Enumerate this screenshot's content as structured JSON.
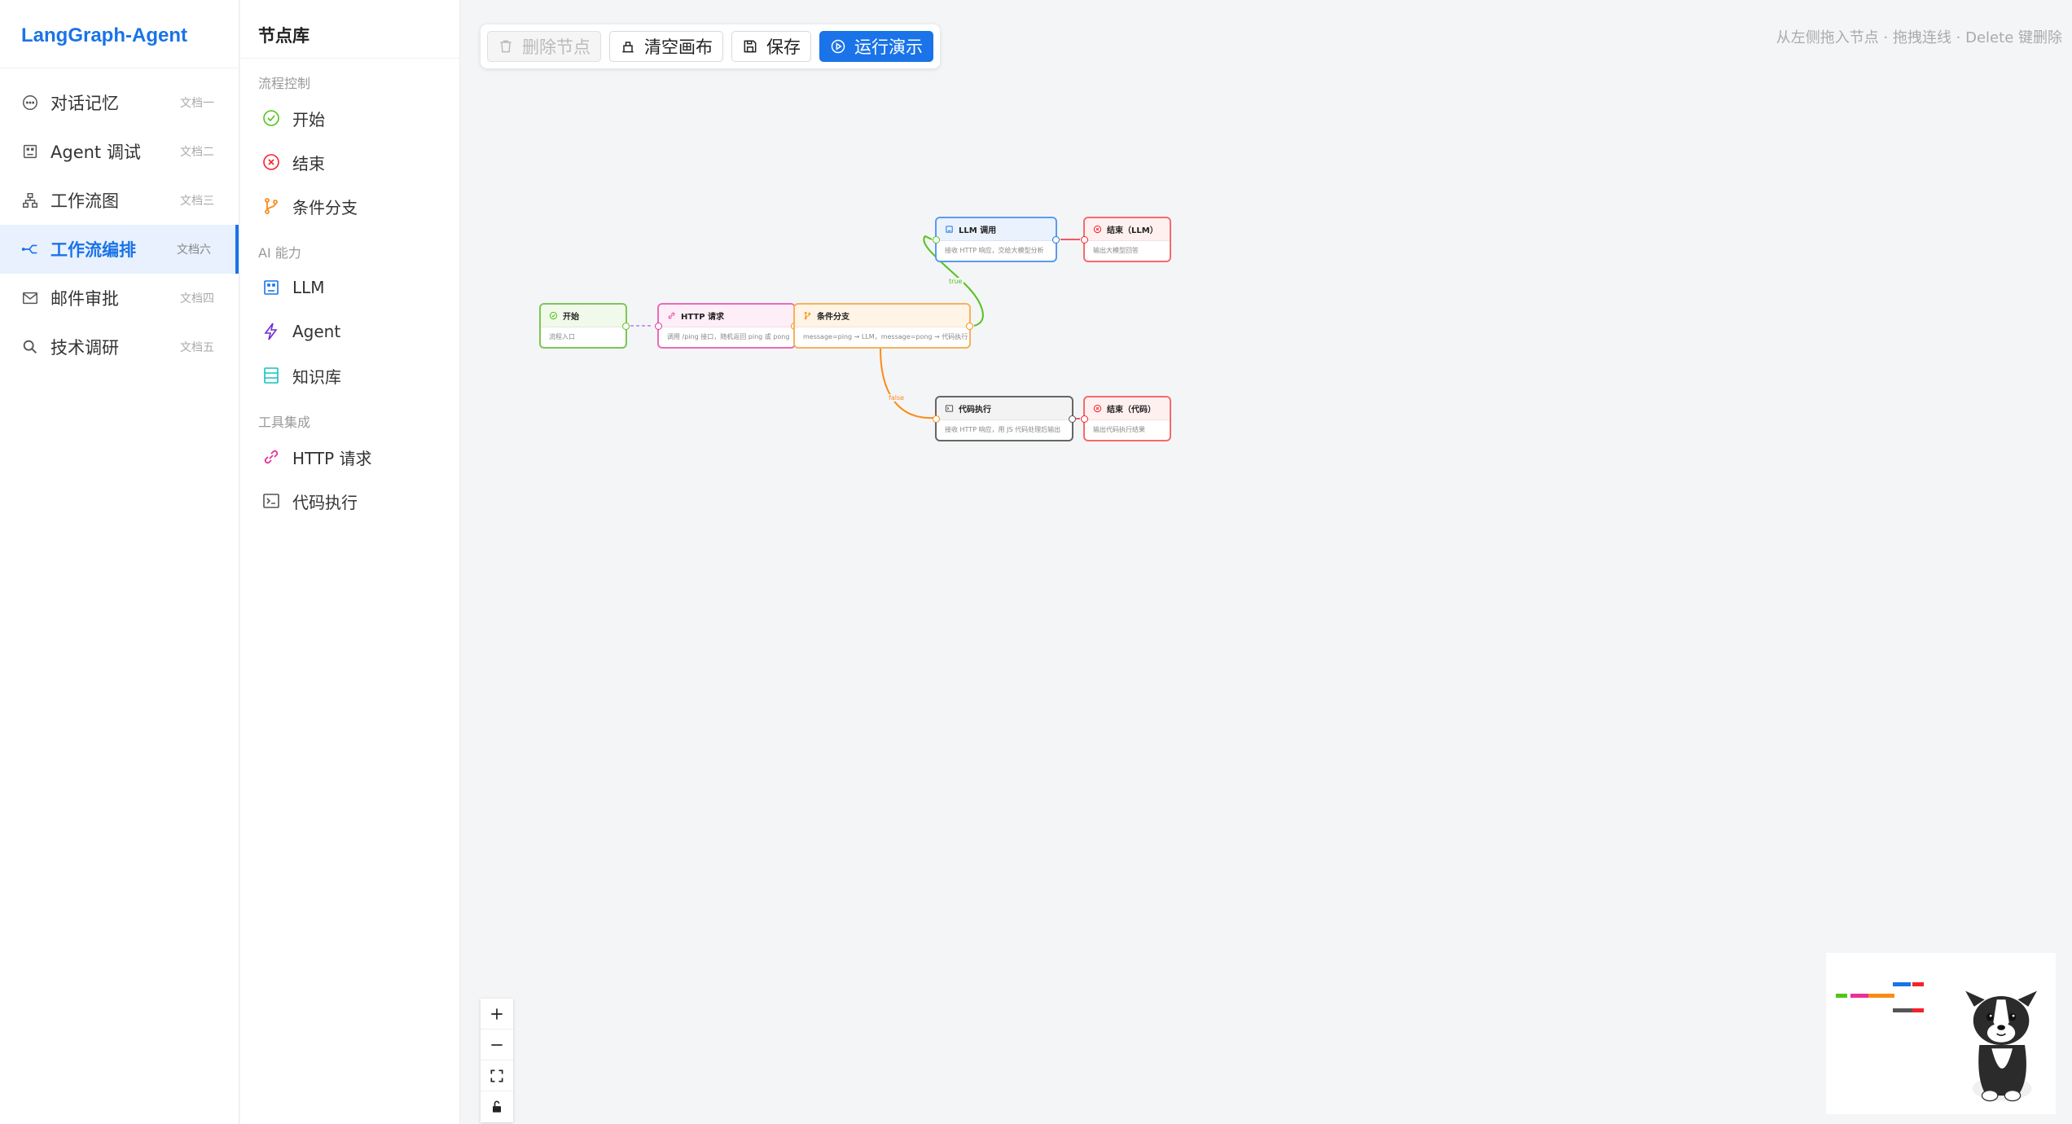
{
  "app": {
    "title": "LangGraph-Agent"
  },
  "sidebar": {
    "items": [
      {
        "label": "对话记忆",
        "sub": "文档一",
        "icon": "chat-bubble-icon",
        "active": false
      },
      {
        "label": "Agent 调试",
        "sub": "文档二",
        "icon": "robot-icon",
        "active": false
      },
      {
        "label": "工作流图",
        "sub": "文档三",
        "icon": "sitemap-icon",
        "active": false
      },
      {
        "label": "工作流编排",
        "sub": "文档六",
        "icon": "workflow-icon",
        "active": true
      },
      {
        "label": "邮件审批",
        "sub": "文档四",
        "icon": "mail-icon",
        "active": false
      },
      {
        "label": "技术调研",
        "sub": "文档五",
        "icon": "search-icon",
        "active": false
      }
    ]
  },
  "library": {
    "title": "节点库",
    "groups": [
      {
        "title": "流程控制",
        "items": [
          {
            "label": "开始",
            "icon": "check-circle-icon",
            "color": "#52c41a"
          },
          {
            "label": "结束",
            "icon": "x-circle-icon",
            "color": "#f5222d"
          },
          {
            "label": "条件分支",
            "icon": "branch-icon",
            "color": "#fa8c16"
          }
        ]
      },
      {
        "title": "AI 能力",
        "items": [
          {
            "label": "LLM",
            "icon": "robot-icon",
            "color": "#1a73e8"
          },
          {
            "label": "Agent",
            "icon": "lightning-icon",
            "color": "#722ed1"
          },
          {
            "label": "知识库",
            "icon": "database-icon",
            "color": "#13c2c2"
          }
        ]
      },
      {
        "title": "工具集成",
        "items": [
          {
            "label": "HTTP 请求",
            "icon": "link-icon",
            "color": "#eb2f96"
          },
          {
            "label": "代码执行",
            "icon": "terminal-icon",
            "color": "#555555"
          }
        ]
      }
    ]
  },
  "toolbar": {
    "delete_label": "删除节点",
    "clear_label": "清空画布",
    "save_label": "保存",
    "run_label": "运行演示"
  },
  "hint": "从左侧拖入节点 · 拖拽连线 · Delete 键删除",
  "nodes": {
    "start": {
      "title": "开始",
      "desc": "流程入口"
    },
    "http": {
      "title": "HTTP 请求",
      "desc": "调用 /ping 接口，随机返回 ping 或 pong"
    },
    "cond": {
      "title": "条件分支",
      "desc": "message=ping → LLM，message=pong → 代码执行"
    },
    "llm": {
      "title": "LLM 调用",
      "desc": "接收 HTTP 响应，交给大模型分析"
    },
    "end_llm": {
      "title": "结束（LLM）",
      "desc": "输出大模型回答"
    },
    "code": {
      "title": "代码执行",
      "desc": "接收 HTTP 响应，用 JS 代码处理后输出"
    },
    "end_code": {
      "title": "结束（代码）",
      "desc": "输出代码执行结果"
    }
  },
  "edges": {
    "true_label": "true",
    "false_label": "false"
  },
  "colors": {
    "accent": "#1a73e8",
    "start": "#52c41a",
    "end": "#f5222d",
    "condition": "#fa8c16",
    "http": "#eb2f96",
    "code": "#555555"
  }
}
